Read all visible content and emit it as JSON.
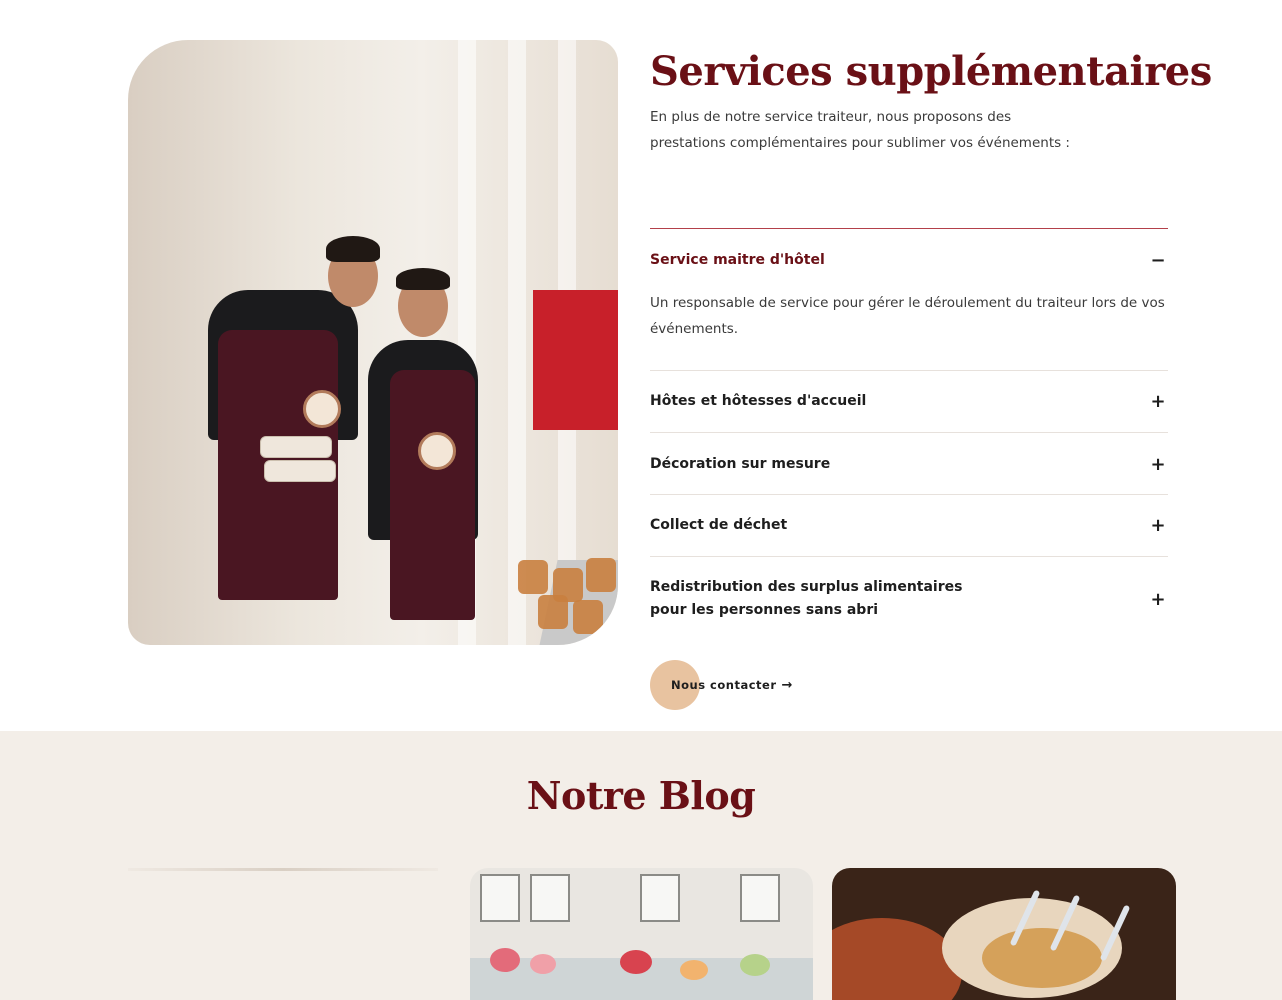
{
  "services": {
    "title": "Services supplémentaires",
    "intro": "En plus de notre service traiteur, nous proposons des prestations complémentaires pour sublimer vos événements :",
    "items": [
      {
        "title": "Service maitre d'hôtel",
        "toggle": "−",
        "open": true,
        "body": "Un responsable de service pour gérer le déroulement du traiteur lors de vos événements."
      },
      {
        "title": "Hôtes et hôtesses d'accueil",
        "toggle": "+",
        "open": false
      },
      {
        "title": "Décoration sur mesure",
        "toggle": "+",
        "open": false
      },
      {
        "title": "Collect de déchet",
        "toggle": "+",
        "open": false
      },
      {
        "title": "Redistribution des surplus alimentaires pour les personnes sans abri",
        "toggle": "+",
        "open": false
      }
    ],
    "contact_label": "Nous contacter",
    "contact_arrow": "→"
  },
  "blog": {
    "title": "Notre Blog"
  },
  "colors": {
    "accent": "#6a1016",
    "button_blob": "#e8c3a0",
    "blog_bg": "#f3eee8",
    "divider_active": "#b3404a"
  }
}
